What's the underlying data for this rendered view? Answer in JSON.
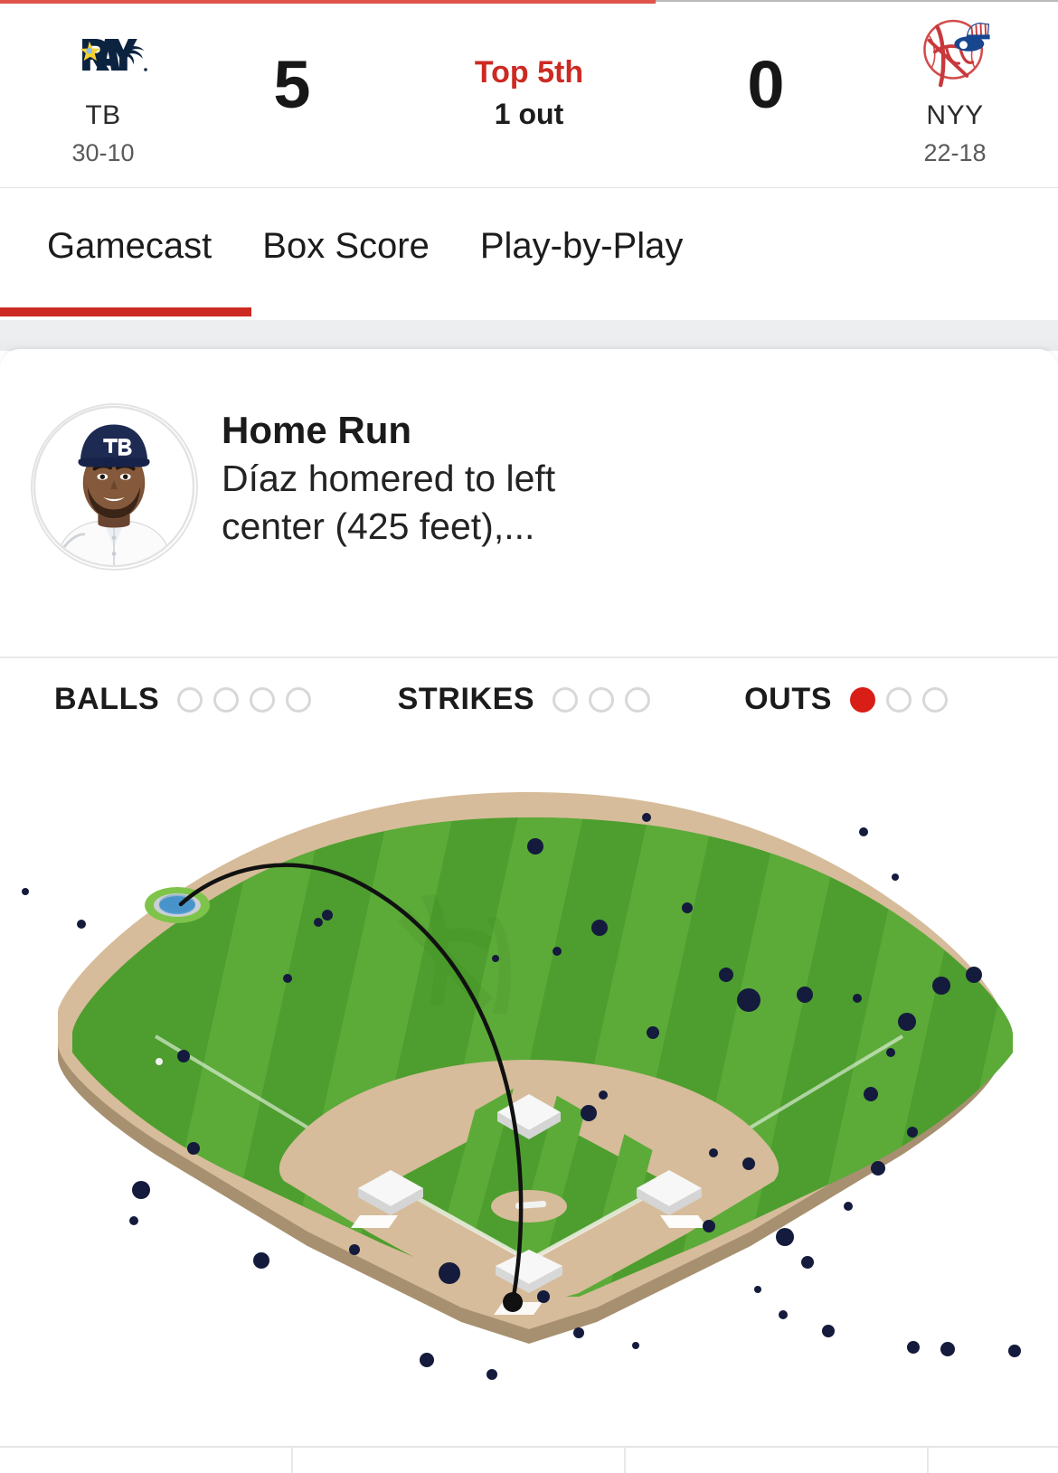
{
  "top_bar": {
    "progress_percent": 62,
    "accent_color": "#de5449"
  },
  "header": {
    "away": {
      "abbr": "TB",
      "record": "30-10",
      "score": "5",
      "logo_icon": "rays-logo-icon",
      "name": "Tampa Bay Rays"
    },
    "home": {
      "abbr": "NYY",
      "record": "22-18",
      "score": "0",
      "logo_icon": "yankees-logo-icon",
      "name": "New York Yankees"
    },
    "status": {
      "inning": "Top 5th",
      "outs_text": "1 out",
      "inning_color": "#cc2a22"
    }
  },
  "tabs": {
    "items": [
      {
        "label": "Gamecast",
        "active": true
      },
      {
        "label": "Box Score",
        "active": false
      },
      {
        "label": "Play-by-Play",
        "active": false
      }
    ],
    "active_underline_color": "#cc2a22"
  },
  "play": {
    "avatar_icon": "player-headshot-avatar",
    "title": "Home Run",
    "description": "Díaz homered to left center (425 feet),..."
  },
  "count": {
    "balls": {
      "label": "BALLS",
      "total": 4,
      "filled": 0
    },
    "strikes": {
      "label": "STRIKES",
      "total": 3,
      "filled": 0
    },
    "outs": {
      "label": "OUTS",
      "total": 3,
      "filled": 1,
      "fill_color": "#d91e18"
    }
  },
  "field": {
    "name": "baseball-field-diagram",
    "grass_color": "#4d9e2e",
    "grass_stripe_color": "#5cab39",
    "dirt_color": "#d6bc9a",
    "dirt_shadow_color": "#a79070",
    "hit_dot_color": "#141b3d",
    "landing_marker_color": "#4f9ed6",
    "landing_marker_halo_color": "#7ec44a",
    "trajectory_color": "#111111",
    "distance_feet": 425,
    "direction": "left center"
  },
  "footer": {
    "divider_color": "#e4e4e6",
    "cell_separators": 3
  }
}
